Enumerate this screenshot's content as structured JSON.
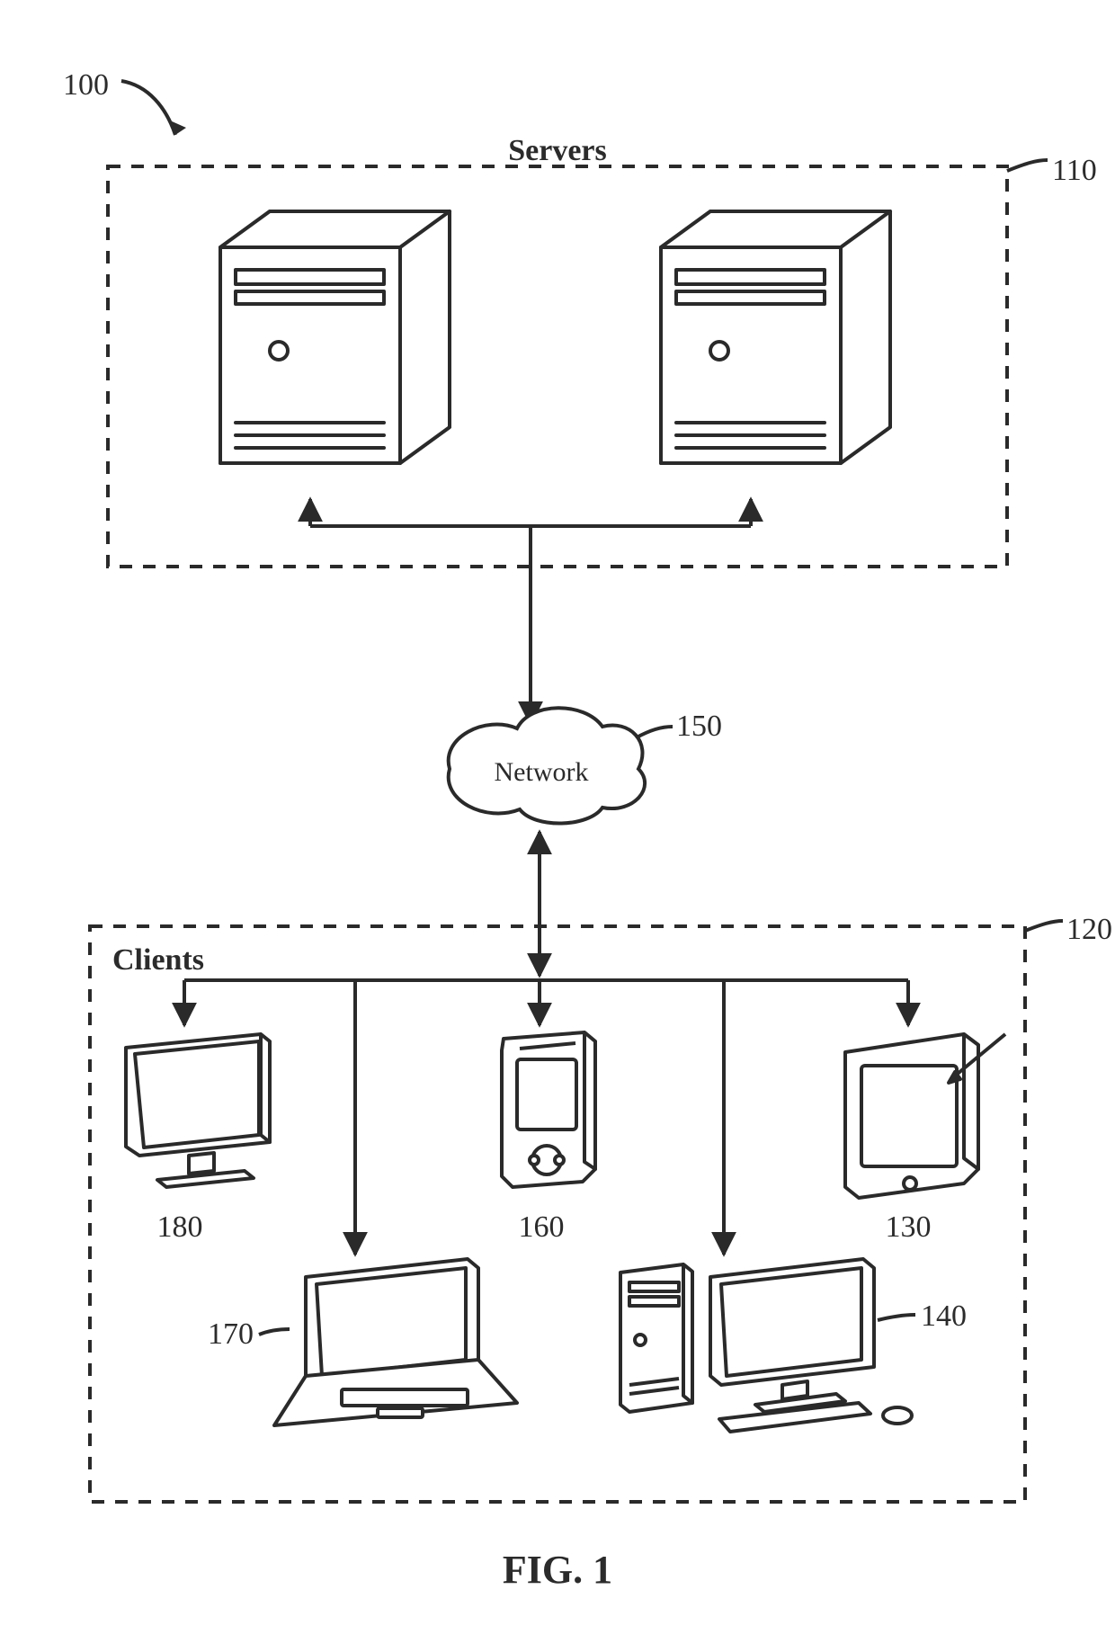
{
  "figure": {
    "overall_ref": "100",
    "caption": "FIG. 1",
    "servers_box": {
      "title": "Servers",
      "ref": "110"
    },
    "clients_box": {
      "title": "Clients",
      "ref": "120"
    },
    "network": {
      "label": "Network",
      "ref": "150"
    },
    "clients": {
      "tablet": {
        "ref": "130"
      },
      "desktop": {
        "ref": "140"
      },
      "phone": {
        "ref": "160"
      },
      "laptop": {
        "ref": "170"
      },
      "monitor": {
        "ref": "180"
      }
    }
  }
}
